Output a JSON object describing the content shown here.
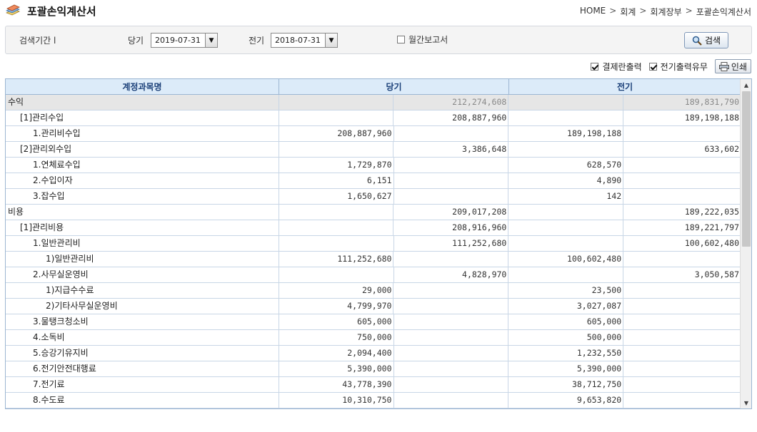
{
  "header": {
    "title": "포괄손익계산서",
    "breadcrumb": [
      "HOME",
      "회계",
      "회계장부",
      "포괄손익계산서"
    ],
    "breadcrumb_sep": ">"
  },
  "search": {
    "period_label": "검색기간 l",
    "current_label": "당기",
    "current_value": "2019-07-31",
    "previous_label": "전기",
    "previous_value": "2018-07-31",
    "monthly_report_label": "월간보고서",
    "monthly_report_checked": false,
    "search_button": "검색"
  },
  "options": {
    "approval_print_label": "결제란출력",
    "approval_print_checked": true,
    "previous_print_label": "전기출력유무",
    "previous_print_checked": true,
    "print_button": "인쇄"
  },
  "table": {
    "columns": [
      "계정과목명",
      "당기",
      "전기"
    ],
    "rows": [
      {
        "name": "수익",
        "c1": "",
        "c2": "212,274,608",
        "p1": "",
        "p2": "189,831,790"
      },
      {
        "name": "[1]관리수입",
        "c1": "",
        "c2": "208,887,960",
        "p1": "",
        "p2": "189,198,188"
      },
      {
        "name": "1.관리비수입",
        "c1": "208,887,960",
        "c2": "",
        "p1": "189,198,188",
        "p2": ""
      },
      {
        "name": "[2]관리외수입",
        "c1": "",
        "c2": "3,386,648",
        "p1": "",
        "p2": "633,602"
      },
      {
        "name": "1.연체료수입",
        "c1": "1,729,870",
        "c2": "",
        "p1": "628,570",
        "p2": ""
      },
      {
        "name": "2.수입이자",
        "c1": "6,151",
        "c2": "",
        "p1": "4,890",
        "p2": ""
      },
      {
        "name": "3.잡수입",
        "c1": "1,650,627",
        "c2": "",
        "p1": "142",
        "p2": ""
      },
      {
        "name": "비용",
        "c1": "",
        "c2": "209,017,208",
        "p1": "",
        "p2": "189,222,035"
      },
      {
        "name": "[1]관리비용",
        "c1": "",
        "c2": "208,916,960",
        "p1": "",
        "p2": "189,221,797"
      },
      {
        "name": "1.일반관리비",
        "c1": "",
        "c2": "111,252,680",
        "p1": "",
        "p2": "100,602,480"
      },
      {
        "name": "1)일반관리비",
        "c1": "111,252,680",
        "c2": "",
        "p1": "100,602,480",
        "p2": ""
      },
      {
        "name": "2.사무실운영비",
        "c1": "",
        "c2": "4,828,970",
        "p1": "",
        "p2": "3,050,587"
      },
      {
        "name": "1)지급수수료",
        "c1": "29,000",
        "c2": "",
        "p1": "23,500",
        "p2": ""
      },
      {
        "name": "2)기타사무실운영비",
        "c1": "4,799,970",
        "c2": "",
        "p1": "3,027,087",
        "p2": ""
      },
      {
        "name": "3.물탱크청소비",
        "c1": "605,000",
        "c2": "",
        "p1": "605,000",
        "p2": ""
      },
      {
        "name": "4.소독비",
        "c1": "750,000",
        "c2": "",
        "p1": "500,000",
        "p2": ""
      },
      {
        "name": "5.승강기유지비",
        "c1": "2,094,400",
        "c2": "",
        "p1": "1,232,550",
        "p2": ""
      },
      {
        "name": "6.전기안전대행료",
        "c1": "5,390,000",
        "c2": "",
        "p1": "5,390,000",
        "p2": ""
      },
      {
        "name": "7.전기료",
        "c1": "43,778,390",
        "c2": "",
        "p1": "38,712,750",
        "p2": ""
      },
      {
        "name": "8.수도료",
        "c1": "10,310,750",
        "c2": "",
        "p1": "9,653,820",
        "p2": ""
      }
    ]
  }
}
